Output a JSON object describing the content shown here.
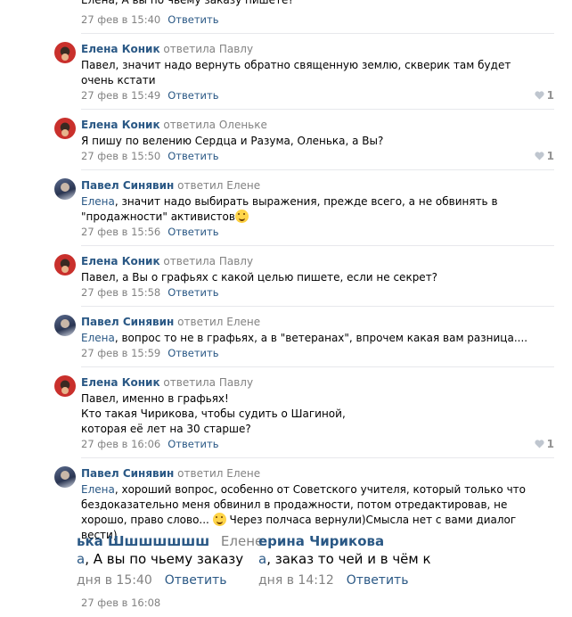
{
  "comments": [
    {
      "text_link": "",
      "text": "Елена, А вы по чьему заказу пишете?",
      "date": "27 фев в 15:40",
      "reply": "Ответить"
    },
    {
      "author": "Елена Коник",
      "replied_to": "ответила Павлу",
      "text": "Павел, значит надо вернуть обратно священную землю, скверик там будет очень кстати",
      "date": "27 фев в 15:49",
      "reply": "Ответить",
      "likes": "1"
    },
    {
      "author": "Елена Коник",
      "replied_to": "ответила Оленьке",
      "text": "Я пишу по велению Сердца и Разума, Оленька, а Вы?",
      "date": "27 фев в 15:50",
      "reply": "Ответить",
      "likes": "1"
    },
    {
      "author": "Павел Синявин",
      "replied_to": "ответил Елене",
      "text_link": "Елена",
      "text": ", значит надо выбирать выражения, прежде всего, а не обвинять в \"продажности\" активистов",
      "date": "27 фев в 15:56",
      "reply": "Ответить"
    },
    {
      "author": "Елена Коник",
      "replied_to": "ответила Павлу",
      "text": "Павел, а Вы о графьях с какой целью пишете, если не секрет?",
      "date": "27 фев в 15:58",
      "reply": "Ответить"
    },
    {
      "author": "Павел Синявин",
      "replied_to": "ответил Елене",
      "text_link": "Елена",
      "text": ", вопрос то не в графьях, а в \"ветеранах\", впрочем какая вам разница....",
      "date": "27 фев в 15:59",
      "reply": "Ответить"
    },
    {
      "author": "Елена Коник",
      "replied_to": "ответила Павлу",
      "text_lines": [
        "Павел, именно в графьях!",
        "Кто такая Чирикова, чтобы судить о Шагиной,",
        "которая её лет на 30 старше?"
      ],
      "date": "27 фев в 16:06",
      "reply": "Ответить",
      "likes": "1"
    },
    {
      "author": "Павел Синявин",
      "replied_to": "ответил Елене",
      "text_link": "Елена",
      "text": ", хороший вопрос, особенно от Советского учителя, который только что бездоказательно меня обвинил в продажности, потом отредактировав, не хорошо, право слово...",
      "text_after_emoji": " Через полчаса вернули)Смысла нет с вами диалог вести)",
      "date": "27 фев в 16:08"
    }
  ],
  "attached_screenshot": {
    "row1_left_author": "ька Шшшшшшш",
    "row1_left_replied": "Елене",
    "row1_right_author": "ерина Чирикова",
    "row2_left_link": "а",
    "row2_left_text": ", А вы по чьему заказу",
    "row2_right_link": "а",
    "row2_right_text": ", заказ то чей и в чём к",
    "row3_left_date": "дня в 15:40",
    "row3_left_reply": "Ответить",
    "row3_right_date": "дня в 14:12",
    "row3_right_reply": "Ответить"
  },
  "colors": {
    "link": "#2a5885",
    "muted": "#828282",
    "separator": "#e7e8ec"
  },
  "icons": {
    "like": "heart-icon",
    "emoji": "smile-emoji-icon"
  }
}
